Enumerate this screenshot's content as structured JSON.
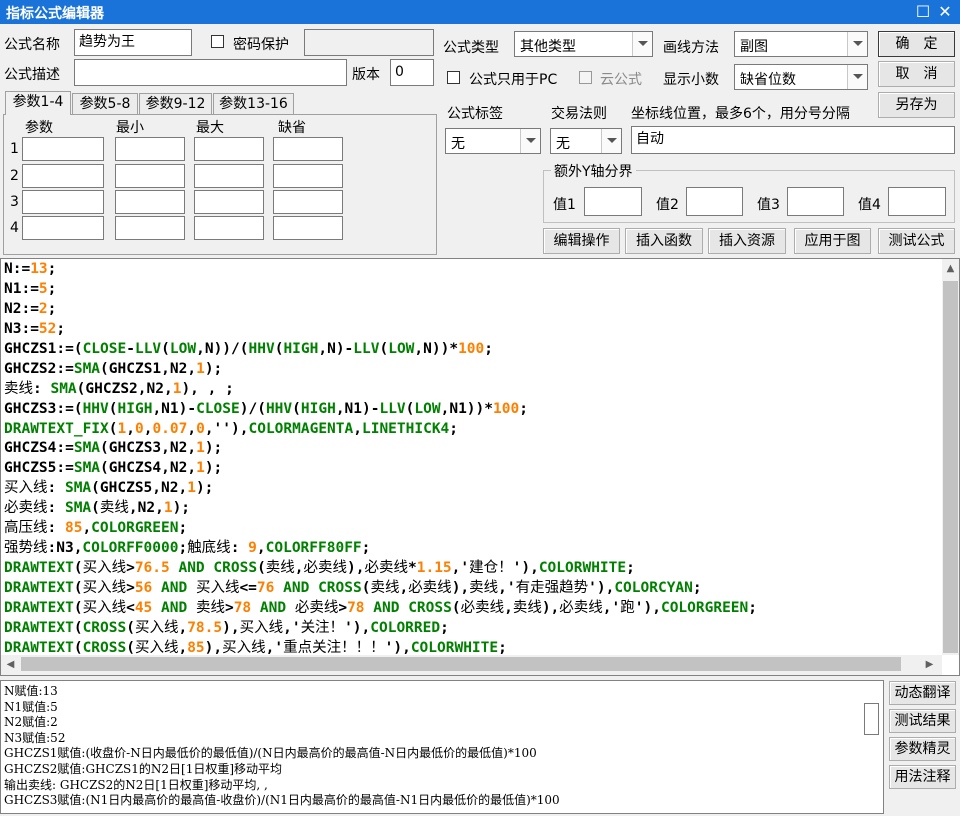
{
  "window": {
    "title": "指标公式编辑器",
    "maximize_glyph": "☐",
    "close_glyph": "✕"
  },
  "form": {
    "name_label": "公式名称",
    "name_value": "趋势为王",
    "password_label": "密码保护",
    "type_label": "公式类型",
    "type_value": "其他类型",
    "draw_label": "画线方法",
    "draw_value": "副图",
    "desc_label": "公式描述",
    "desc_value": "",
    "version_label": "版本",
    "version_value": "0",
    "pc_only_label": "公式只用于PC",
    "cloud_label": "云公式",
    "decimal_label": "显示小数",
    "decimal_value": "缺省位数",
    "tag_label": "公式标签",
    "tag_value": "无",
    "trade_label": "交易法则",
    "trade_value": "无",
    "coord_label": "坐标线位置，最多6个，用分号分隔",
    "coord_value": "自动",
    "yaxis_group": "额外Y轴分界",
    "y_values": [
      "值1",
      "值2",
      "值3",
      "值4"
    ]
  },
  "buttons": {
    "ok": "确　定",
    "cancel": "取　消",
    "save_as": "另存为",
    "edit_op": "编辑操作",
    "insert_func": "插入函数",
    "insert_res": "插入资源",
    "apply_chart": "应用于图",
    "test_formula": "测试公式",
    "dyn_translate": "动态翻译",
    "test_result": "测试结果",
    "param_wizard": "参数精灵",
    "usage_note": "用法注释"
  },
  "param_tabs": [
    "参数1-4",
    "参数5-8",
    "参数9-12",
    "参数13-16"
  ],
  "param_headers": [
    "参数",
    "最小",
    "最大",
    "缺省"
  ],
  "param_rows": [
    "1",
    "2",
    "3",
    "4"
  ],
  "code_lines": [
    [
      [
        "p",
        "N:="
      ],
      [
        "n",
        "13"
      ],
      [
        "p",
        ";"
      ]
    ],
    [
      [
        "p",
        "N1:="
      ],
      [
        "n",
        "5"
      ],
      [
        "p",
        ";"
      ]
    ],
    [
      [
        "p",
        "N2:="
      ],
      [
        "n",
        "2"
      ],
      [
        "p",
        ";"
      ]
    ],
    [
      [
        "p",
        "N3:="
      ],
      [
        "n",
        "52"
      ],
      [
        "p",
        ";"
      ]
    ],
    [
      [
        "p",
        "GHCZS1:=("
      ],
      [
        "f",
        "CLOSE"
      ],
      [
        "p",
        "-"
      ],
      [
        "f",
        "LLV"
      ],
      [
        "p",
        "("
      ],
      [
        "f",
        "LOW"
      ],
      [
        "p",
        ",N))/("
      ],
      [
        "f",
        "HHV"
      ],
      [
        "p",
        "("
      ],
      [
        "f",
        "HIGH"
      ],
      [
        "p",
        ",N)-"
      ],
      [
        "f",
        "LLV"
      ],
      [
        "p",
        "("
      ],
      [
        "f",
        "LOW"
      ],
      [
        "p",
        ",N))*"
      ],
      [
        "n",
        "100"
      ],
      [
        "p",
        ";"
      ]
    ],
    [
      [
        "p",
        "GHCZS2:="
      ],
      [
        "f",
        "SMA"
      ],
      [
        "p",
        "(GHCZS1,N2,"
      ],
      [
        "n",
        "1"
      ],
      [
        "p",
        ");"
      ]
    ],
    [
      [
        "c",
        "卖线"
      ],
      [
        "p",
        ": "
      ],
      [
        "f",
        "SMA"
      ],
      [
        "p",
        "(GHCZS2,N2,"
      ],
      [
        "n",
        "1"
      ],
      [
        "p",
        "), , ;"
      ]
    ],
    [
      [
        "p",
        "GHCZS3:=("
      ],
      [
        "f",
        "HHV"
      ],
      [
        "p",
        "("
      ],
      [
        "f",
        "HIGH"
      ],
      [
        "p",
        ",N1)-"
      ],
      [
        "f",
        "CLOSE"
      ],
      [
        "p",
        ")/("
      ],
      [
        "f",
        "HHV"
      ],
      [
        "p",
        "("
      ],
      [
        "f",
        "HIGH"
      ],
      [
        "p",
        ",N1)-"
      ],
      [
        "f",
        "LLV"
      ],
      [
        "p",
        "("
      ],
      [
        "f",
        "LOW"
      ],
      [
        "p",
        ",N1))*"
      ],
      [
        "n",
        "100"
      ],
      [
        "p",
        ";"
      ]
    ],
    [
      [
        "f",
        "DRAWTEXT_FIX"
      ],
      [
        "p",
        "("
      ],
      [
        "n",
        "1"
      ],
      [
        "p",
        ","
      ],
      [
        "n",
        "0"
      ],
      [
        "p",
        ","
      ],
      [
        "n",
        "0.07"
      ],
      [
        "p",
        ","
      ],
      [
        "n",
        "0"
      ],
      [
        "p",
        ",''),"
      ],
      [
        "f",
        "COLORMAGENTA"
      ],
      [
        "p",
        ","
      ],
      [
        "f",
        "LINETHICK4"
      ],
      [
        "p",
        ";"
      ]
    ],
    [
      [
        "p",
        "GHCZS4:="
      ],
      [
        "f",
        "SMA"
      ],
      [
        "p",
        "(GHCZS3,N2,"
      ],
      [
        "n",
        "1"
      ],
      [
        "p",
        ");"
      ]
    ],
    [
      [
        "p",
        "GHCZS5:="
      ],
      [
        "f",
        "SMA"
      ],
      [
        "p",
        "(GHCZS4,N2,"
      ],
      [
        "n",
        "1"
      ],
      [
        "p",
        ");"
      ]
    ],
    [
      [
        "c",
        "买入线"
      ],
      [
        "p",
        ": "
      ],
      [
        "f",
        "SMA"
      ],
      [
        "p",
        "(GHCZS5,N2,"
      ],
      [
        "n",
        "1"
      ],
      [
        "p",
        ");"
      ]
    ],
    [
      [
        "c",
        "必卖线"
      ],
      [
        "p",
        ": "
      ],
      [
        "f",
        "SMA"
      ],
      [
        "p",
        "("
      ],
      [
        "c",
        "卖线"
      ],
      [
        "p",
        ",N2,"
      ],
      [
        "n",
        "1"
      ],
      [
        "p",
        ");"
      ]
    ],
    [
      [
        "c",
        "高压线"
      ],
      [
        "p",
        ": "
      ],
      [
        "n",
        "85"
      ],
      [
        "p",
        ","
      ],
      [
        "f",
        "COLORGREEN"
      ],
      [
        "p",
        ";"
      ]
    ],
    [
      [
        "c",
        "强势线"
      ],
      [
        "p",
        ":N3,"
      ],
      [
        "f",
        "COLORFF0000"
      ],
      [
        "p",
        ";"
      ],
      [
        "c",
        "触底线"
      ],
      [
        "p",
        ": "
      ],
      [
        "n",
        "9"
      ],
      [
        "p",
        ","
      ],
      [
        "f",
        "COLORFF80FF"
      ],
      [
        "p",
        ";"
      ]
    ],
    [
      [
        "f",
        "DRAWTEXT"
      ],
      [
        "p",
        "("
      ],
      [
        "c",
        "买入线"
      ],
      [
        "p",
        ">"
      ],
      [
        "n",
        "76.5"
      ],
      [
        "p",
        " "
      ],
      [
        "f",
        "AND"
      ],
      [
        "p",
        " "
      ],
      [
        "f",
        "CROSS"
      ],
      [
        "p",
        "("
      ],
      [
        "c",
        "卖线"
      ],
      [
        "p",
        ","
      ],
      [
        "c",
        "必卖线"
      ],
      [
        "p",
        "),"
      ],
      [
        "c",
        "必卖线"
      ],
      [
        "p",
        "*"
      ],
      [
        "n",
        "1.15"
      ],
      [
        "p",
        ",'"
      ],
      [
        "c",
        "建仓！"
      ],
      [
        "p",
        "'),"
      ],
      [
        "f",
        "COLORWHITE"
      ],
      [
        "p",
        ";"
      ]
    ],
    [
      [
        "f",
        "DRAWTEXT"
      ],
      [
        "p",
        "("
      ],
      [
        "c",
        "买入线"
      ],
      [
        "p",
        ">"
      ],
      [
        "n",
        "56"
      ],
      [
        "p",
        " "
      ],
      [
        "f",
        "AND"
      ],
      [
        "p",
        " "
      ],
      [
        "c",
        "买入线"
      ],
      [
        "p",
        "<="
      ],
      [
        "n",
        "76"
      ],
      [
        "p",
        " "
      ],
      [
        "f",
        "AND"
      ],
      [
        "p",
        " "
      ],
      [
        "f",
        "CROSS"
      ],
      [
        "p",
        "("
      ],
      [
        "c",
        "卖线"
      ],
      [
        "p",
        ","
      ],
      [
        "c",
        "必卖线"
      ],
      [
        "p",
        "),"
      ],
      [
        "c",
        "卖线"
      ],
      [
        "p",
        ",'"
      ],
      [
        "c",
        "有走强趋势"
      ],
      [
        "p",
        "'),"
      ],
      [
        "f",
        "COLORCYAN"
      ],
      [
        "p",
        ";"
      ]
    ],
    [
      [
        "f",
        "DRAWTEXT"
      ],
      [
        "p",
        "("
      ],
      [
        "c",
        "买入线"
      ],
      [
        "p",
        "<"
      ],
      [
        "n",
        "45"
      ],
      [
        "p",
        " "
      ],
      [
        "f",
        "AND"
      ],
      [
        "p",
        " "
      ],
      [
        "c",
        "卖线"
      ],
      [
        "p",
        ">"
      ],
      [
        "n",
        "78"
      ],
      [
        "p",
        " "
      ],
      [
        "f",
        "AND"
      ],
      [
        "p",
        " "
      ],
      [
        "c",
        "必卖线"
      ],
      [
        "p",
        ">"
      ],
      [
        "n",
        "78"
      ],
      [
        "p",
        " "
      ],
      [
        "f",
        "AND"
      ],
      [
        "p",
        " "
      ],
      [
        "f",
        "CROSS"
      ],
      [
        "p",
        "("
      ],
      [
        "c",
        "必卖线"
      ],
      [
        "p",
        ","
      ],
      [
        "c",
        "卖线"
      ],
      [
        "p",
        "),"
      ],
      [
        "c",
        "必卖线"
      ],
      [
        "p",
        ",'"
      ],
      [
        "c",
        "跑"
      ],
      [
        "p",
        "'),"
      ],
      [
        "f",
        "COLORGREEN"
      ],
      [
        "p",
        ";"
      ]
    ],
    [
      [
        "f",
        "DRAWTEXT"
      ],
      [
        "p",
        "("
      ],
      [
        "f",
        "CROSS"
      ],
      [
        "p",
        "("
      ],
      [
        "c",
        "买入线"
      ],
      [
        "p",
        ","
      ],
      [
        "n",
        "78.5"
      ],
      [
        "p",
        "),"
      ],
      [
        "c",
        "买入线"
      ],
      [
        "p",
        ",'"
      ],
      [
        "c",
        "关注！"
      ],
      [
        "p",
        "'),"
      ],
      [
        "f",
        "COLORRED"
      ],
      [
        "p",
        ";"
      ]
    ],
    [
      [
        "f",
        "DRAWTEXT"
      ],
      [
        "p",
        "("
      ],
      [
        "f",
        "CROSS"
      ],
      [
        "p",
        "("
      ],
      [
        "c",
        "买入线"
      ],
      [
        "p",
        ","
      ],
      [
        "n",
        "85"
      ],
      [
        "p",
        "),"
      ],
      [
        "c",
        "买入线"
      ],
      [
        "p",
        ",'"
      ],
      [
        "c",
        "重点关注！！！"
      ],
      [
        "p",
        "'),"
      ],
      [
        "f",
        "COLORWHITE"
      ],
      [
        "p",
        ";"
      ]
    ]
  ],
  "output_lines": [
    "N赋值:13",
    "N1赋值:5",
    "N2赋值:2",
    "N3赋值:52",
    "GHCZS1赋值:(收盘价-N日内最低价的最低值)/(N日内最高价的最高值-N日内最低价的最低值)*100",
    "GHCZS2赋值:GHCZS1的N2日[1日权重]移动平均",
    "输出卖线: GHCZS2的N2日[1日权重]移动平均, ,",
    "GHCZS3赋值:(N1日内最高价的最高值-收盘价)/(N1日内最高价的最高值-N1日内最低价的最低值)*100"
  ]
}
